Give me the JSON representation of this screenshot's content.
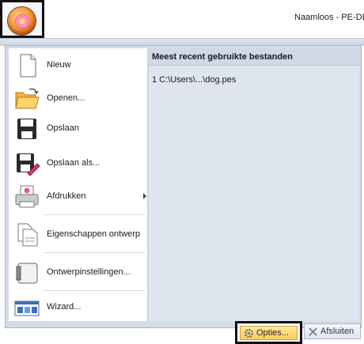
{
  "window": {
    "title": "Naamloos - PE-DE"
  },
  "menu": {
    "items": [
      {
        "label": "Nieuw",
        "icon": "new-document-icon"
      },
      {
        "label": "Openen...",
        "icon": "open-folder-icon"
      },
      {
        "label": "Opslaan",
        "icon": "save-icon"
      },
      {
        "label": "Opslaan als...",
        "icon": "save-as-icon"
      },
      {
        "label": "Afdrukken",
        "icon": "print-icon",
        "submenu": true
      },
      {
        "label": "Eigenschappen ontwerp",
        "icon": "design-properties-icon"
      },
      {
        "label": "Ontwerpinstellingen...",
        "icon": "design-settings-icon"
      },
      {
        "label": "Wizard...",
        "icon": "wizard-icon"
      }
    ]
  },
  "recent": {
    "header": "Meest recent gebruikte bestanden",
    "files": [
      {
        "label": "1 C:\\Users\\...\\dog.pes"
      }
    ]
  },
  "footer": {
    "options_label": "Opties...",
    "exit_label": "Afsluiten"
  },
  "colors": {
    "highlight_frame": "#111111",
    "options_bg": "#ffcc55",
    "menu_bg": "#d4dce8"
  }
}
